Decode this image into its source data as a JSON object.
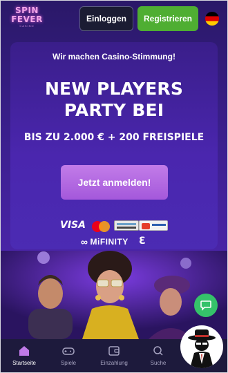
{
  "header": {
    "logo_line1": "SPIN",
    "logo_line2": "FEVER",
    "logo_line3": "CASINO",
    "login_label": "Einloggen",
    "register_label": "Registrieren",
    "language_icon": "germany-flag-icon"
  },
  "promo": {
    "tagline": "Wir machen Casino-Stimmung!",
    "headline_line1": "NEW PLAYERS",
    "headline_line2": "PARTY BEI",
    "subline": "BIS ZU 2.000 € + 200 FREISPIELE",
    "cta_label": "Jetzt anmelden!",
    "payments": {
      "visa": "VISA",
      "mastercard_icon": "mastercard-icon",
      "mifinity": "MiFINITY",
      "e_logo": "Ɛ"
    }
  },
  "chat": {
    "icon": "chat-bubble-icon"
  },
  "nav": {
    "items": [
      {
        "label": "Startseite",
        "icon": "home-icon",
        "active": true
      },
      {
        "label": "Spiele",
        "icon": "gamepad-icon",
        "active": false
      },
      {
        "label": "Einzahlung",
        "icon": "wallet-icon",
        "active": false
      },
      {
        "label": "Suche",
        "icon": "search-icon",
        "active": false
      }
    ]
  },
  "colors": {
    "register_green": "#4fae32",
    "cta_purple": "#b16ae2",
    "background_purple": "#3a1f8c",
    "nav_bg": "#1d1a3c",
    "chat_green": "#35c26a"
  }
}
